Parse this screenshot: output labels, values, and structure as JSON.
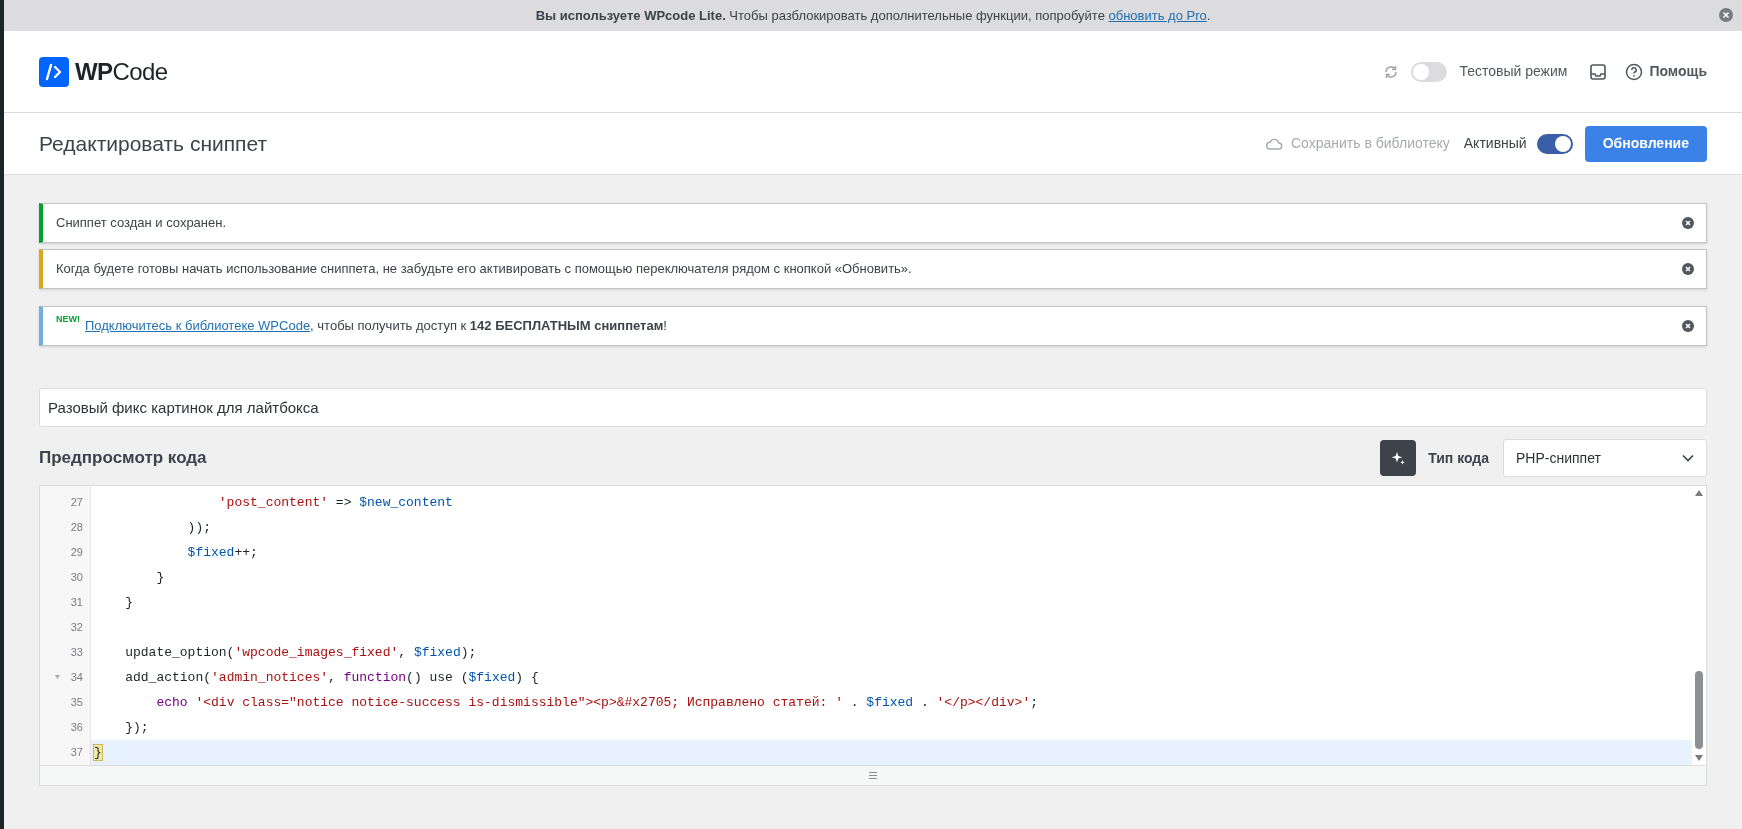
{
  "top_notice": {
    "text": "**Вы используете WPcode Lite.** Чтобы разблокировать дополнительные функции, попробуйте ",
    "link": "обновить до Pro",
    "end": "."
  },
  "header": {
    "logo": "**WP**Code",
    "testing_mode": {
      "label": "Тестовый режим",
      "on": false
    },
    "help": "Помощь"
  },
  "title_bar": {
    "title": "Редактировать сниппет",
    "save_to_library": {
      "label": "Сохранить в библиотеку",
      "disabled": true
    },
    "active": {
      "label": "Активный",
      "on": true
    },
    "update_button": "Обновление"
  },
  "notices": [
    {
      "kind": "success",
      "text": "Сниппет создан и сохранен."
    },
    {
      "kind": "warning",
      "text": "Когда будете готовы начать использование сниппета, не забудьте его активировать с помощью переключателя рядом с кнопкой «Обновить»."
    },
    {
      "kind": "info",
      "badge": "NEW!",
      "link": "Подключитесь к библиотеке WPCode",
      "text": ", чтобы получить доступ к **142 БЕСПЛАТНЫМ сниппетам**!"
    }
  ],
  "snippet_title": "Разовый фикс картинок для лайтбокса",
  "code_preview": {
    "heading": "Предпросмотр кода",
    "code_type_label": "Тип кода",
    "code_type": "PHP-сниппет",
    "lines": [
      {
        "number": "27",
        "foldable": false,
        "selected": false,
        "tokens": [
          {
            "kind": "string",
            "text": "                'post_content'"
          },
          {
            "kind": "plain",
            "text": " => "
          },
          {
            "kind": "variable",
            "text": "$new_content"
          }
        ]
      },
      {
        "number": "28",
        "foldable": false,
        "selected": false,
        "tokens": [
          {
            "kind": "plain",
            "text": "            ));"
          }
        ]
      },
      {
        "number": "29",
        "foldable": false,
        "selected": false,
        "tokens": [
          {
            "kind": "variable",
            "text": "            $fixed"
          },
          {
            "kind": "plain",
            "text": "++;"
          }
        ]
      },
      {
        "number": "30",
        "foldable": false,
        "selected": false,
        "tokens": [
          {
            "kind": "plain",
            "text": "        }"
          }
        ]
      },
      {
        "number": "31",
        "foldable": false,
        "selected": false,
        "tokens": [
          {
            "kind": "plain",
            "text": "    }"
          }
        ]
      },
      {
        "number": "32",
        "foldable": false,
        "selected": false
      },
      {
        "number": "33",
        "foldable": false,
        "selected": false,
        "tokens": [
          {
            "kind": "plain",
            "text": "    update_option("
          },
          {
            "kind": "string",
            "text": "'wpcode_images_fixed'"
          },
          {
            "kind": "plain",
            "text": ", "
          },
          {
            "kind": "variable",
            "text": "$fixed"
          },
          {
            "kind": "plain",
            "text": ");"
          }
        ]
      },
      {
        "number": "34",
        "foldable": true,
        "selected": false,
        "tokens": [
          {
            "kind": "plain",
            "text": "    add_action("
          },
          {
            "kind": "string",
            "text": "'admin_notices'"
          },
          {
            "kind": "plain",
            "text": ", "
          },
          {
            "kind": "keyword",
            "text": "function"
          },
          {
            "kind": "plain",
            "text": "() use ("
          },
          {
            "kind": "variable",
            "text": "$fixed"
          },
          {
            "kind": "plain",
            "text": ") {"
          }
        ]
      },
      {
        "number": "35",
        "foldable": false,
        "selected": false,
        "tokens": [
          {
            "kind": "keyword",
            "text": "        echo"
          },
          {
            "kind": "string",
            "text": " '<div class=\"notice notice-success is-dismissible\"><p>&#x2705; Исправлено статей: '"
          },
          {
            "kind": "plain",
            "text": " . "
          },
          {
            "kind": "variable",
            "text": "$fixed"
          },
          {
            "kind": "plain",
            "text": " . "
          },
          {
            "kind": "string",
            "text": "'</p></div>'"
          },
          {
            "kind": "plain",
            "text": ";"
          }
        ]
      },
      {
        "number": "36",
        "foldable": false,
        "selected": false,
        "tokens": [
          {
            "kind": "plain",
            "text": "    });"
          }
        ]
      },
      {
        "number": "37",
        "foldable": false,
        "selected": true,
        "tokens": [
          {
            "kind": "bracket_match",
            "text": "}"
          }
        ]
      }
    ]
  }
}
